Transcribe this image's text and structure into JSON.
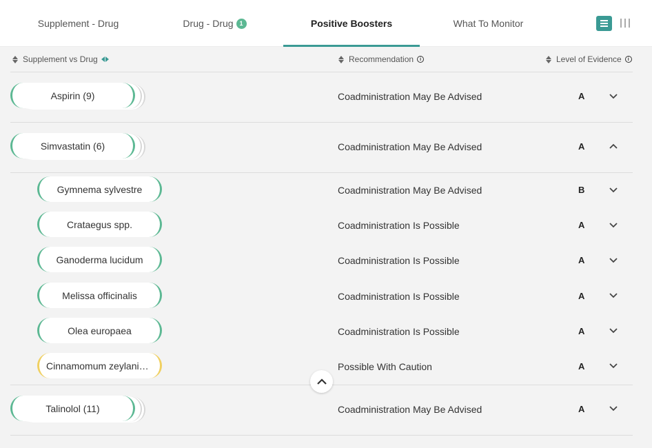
{
  "tabs": [
    {
      "label": "Supplement - Drug"
    },
    {
      "label": "Drug - Drug",
      "badge": "1"
    },
    {
      "label": "Positive Boosters",
      "active": true
    },
    {
      "label": "What To Monitor"
    }
  ],
  "view_toggle": {
    "active": "list-view-icon",
    "inactive": "column-view-icon"
  },
  "columns": {
    "supplement_vs_drug": "Supplement vs Drug",
    "recommendation": "Recommendation",
    "level_of_evidence": "Level of Evidence"
  },
  "rows": [
    {
      "name": "Aspirin (9)",
      "recommendation": "Coadministration May Be Advised",
      "level": "A",
      "expanded": false
    },
    {
      "name": "Simvastatin (6)",
      "recommendation": "Coadministration May Be Advised",
      "level": "A",
      "expanded": true
    },
    {
      "name": "Talinolol (11)",
      "recommendation": "Coadministration May Be Advised",
      "level": "A",
      "expanded": false
    }
  ],
  "children": [
    {
      "name": "Gymnema sylvestre",
      "recommendation": "Coadministration May Be Advised",
      "level": "B",
      "status_color": "#5cb893"
    },
    {
      "name": "Crataegus spp.",
      "recommendation": "Coadministration Is Possible",
      "level": "A",
      "status_color": "#5cb893"
    },
    {
      "name": "Ganoderma lucidum",
      "recommendation": "Coadministration Is Possible",
      "level": "A",
      "status_color": "#5cb893"
    },
    {
      "name": "Melissa officinalis",
      "recommendation": "Coadministration Is Possible",
      "level": "A",
      "status_color": "#5cb893"
    },
    {
      "name": "Olea europaea",
      "recommendation": "Coadministration Is Possible",
      "level": "A",
      "status_color": "#5cb893"
    },
    {
      "name": "Cinnamomum zeylanicum",
      "recommendation": "Possible With Caution",
      "level": "A",
      "status_color": "#f0d061"
    }
  ],
  "colors": {
    "accent": "#3a9a94",
    "positive": "#5cb893",
    "caution": "#f0d061"
  }
}
